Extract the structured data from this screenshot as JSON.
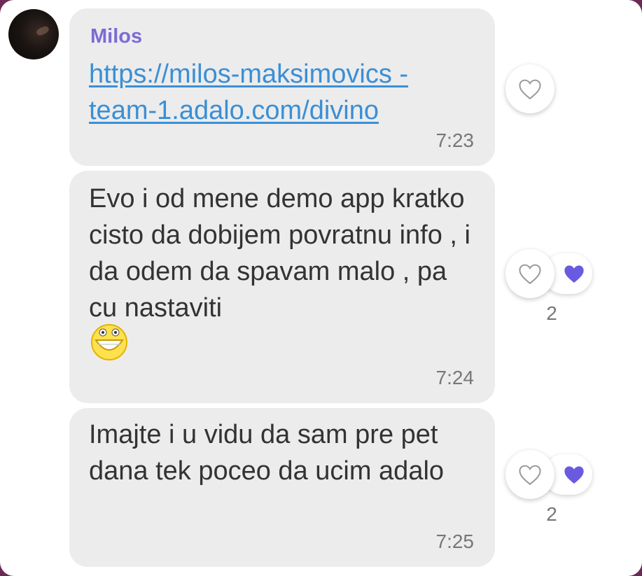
{
  "colors": {
    "sender_name": "#7b6bd6",
    "link": "#3a8fd6",
    "bubble_bg": "#ececec",
    "liked_heart": "#6a5ae0"
  },
  "messages": [
    {
      "sender": "Milos",
      "link": "https://milos-maksimovics -team-1.adalo.com/divino",
      "time": "7:23",
      "reactions": {
        "icon": "heart-outline-icon"
      }
    },
    {
      "text": "Evo i od mene demo app kratko cisto da dobijem povratnu info , i da odem da spavam malo , pa cu nastaviti",
      "emoji": "grinning-face-emoji",
      "time": "7:24",
      "reactions": {
        "icon": "heart-outline-icon",
        "liked_icon": "heart-filled-icon",
        "count": "2"
      }
    },
    {
      "text": "Imajte i u vidu da sam pre pet dana tek poceo da ucim adalo",
      "time": "7:25",
      "reactions": {
        "icon": "heart-outline-icon",
        "liked_icon": "heart-filled-icon",
        "count": "2"
      }
    }
  ]
}
